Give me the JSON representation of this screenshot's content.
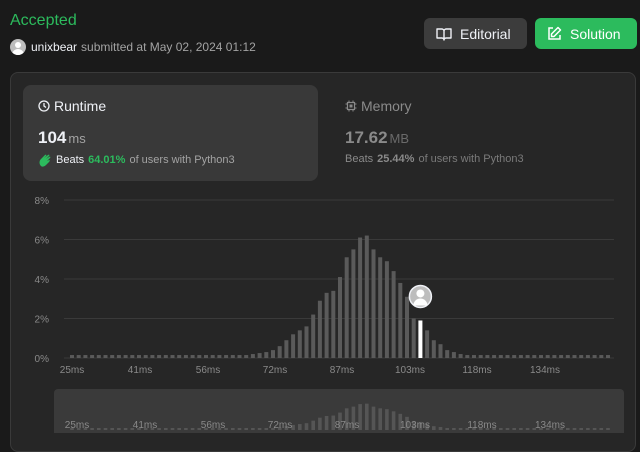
{
  "submission": {
    "status": "Accepted",
    "user": "unixbear",
    "submitted_text": "submitted at May 02, 2024 01:12"
  },
  "actions": {
    "editorial_label": "Editorial",
    "solution_label": "Solution"
  },
  "runtime": {
    "title": "Runtime",
    "value": "104",
    "unit": "ms",
    "beats_word": "Beats",
    "beats_pct": "64.01%",
    "beats_suffix": "of users with Python3"
  },
  "memory": {
    "title": "Memory",
    "value": "17.62",
    "unit": "MB",
    "beats_word": "Beats",
    "beats_pct": "25.44%",
    "beats_suffix": "of users with Python3"
  },
  "colors": {
    "accent": "#2cbb5d",
    "bar": "#5a5a5a",
    "highlight": "#ffffff"
  },
  "chart_data": {
    "type": "bar",
    "y_ticks": [
      "8%",
      "6%",
      "4%",
      "2%",
      "0%"
    ],
    "x_ticks": [
      "25ms",
      "41ms",
      "56ms",
      "72ms",
      "87ms",
      "103ms",
      "118ms",
      "134ms"
    ],
    "ylim": [
      0,
      8
    ],
    "grid": true,
    "highlight_index": 52,
    "values": [
      0.15,
      0.15,
      0.15,
      0.15,
      0.15,
      0.15,
      0.15,
      0.15,
      0.15,
      0.15,
      0.15,
      0.15,
      0.15,
      0.15,
      0.15,
      0.15,
      0.15,
      0.15,
      0.15,
      0.15,
      0.15,
      0.15,
      0.15,
      0.15,
      0.15,
      0.15,
      0.15,
      0.2,
      0.25,
      0.3,
      0.4,
      0.6,
      0.9,
      1.2,
      1.4,
      1.6,
      2.2,
      2.9,
      3.3,
      3.4,
      4.1,
      5.1,
      5.5,
      6.1,
      6.2,
      5.5,
      5.1,
      4.9,
      4.4,
      3.8,
      3.1,
      2.0,
      1.9,
      1.4,
      0.9,
      0.7,
      0.4,
      0.3,
      0.2,
      0.15,
      0.15,
      0.15,
      0.15,
      0.15,
      0.15,
      0.15,
      0.15,
      0.15,
      0.15,
      0.15,
      0.15,
      0.15,
      0.15,
      0.15,
      0.15,
      0.15,
      0.15,
      0.15,
      0.15,
      0.15,
      0.15
    ]
  }
}
